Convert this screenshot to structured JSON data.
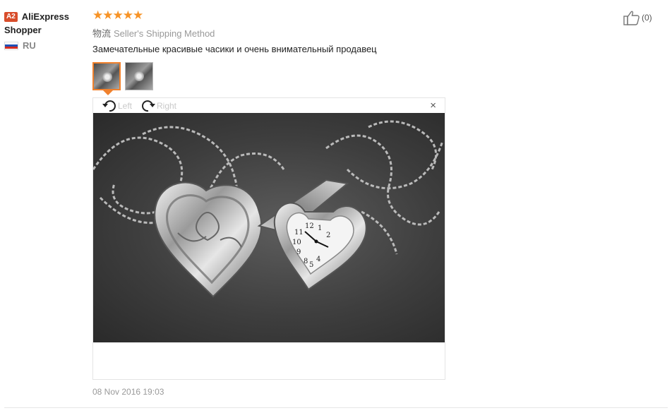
{
  "user": {
    "badge": "A2",
    "name": "AliExpress Shopper",
    "country_code": "RU"
  },
  "review": {
    "rating": 5,
    "star_color": "#f79326",
    "logistics_label": "物流",
    "shipping_method": "Seller's Shipping Method",
    "text": "Замечательные красивые часики и очень внимательный продавец",
    "timestamp": "08 Nov 2016 19:03"
  },
  "viewer": {
    "rotate_left_label": "Left",
    "rotate_right_label": "Right",
    "close_glyph": "×"
  },
  "like": {
    "count": "(0)"
  },
  "icons": [
    "thumbs-up-icon",
    "rotate-left-icon",
    "rotate-right-icon",
    "close-icon",
    "russia-flag-icon",
    "star-icon"
  ]
}
